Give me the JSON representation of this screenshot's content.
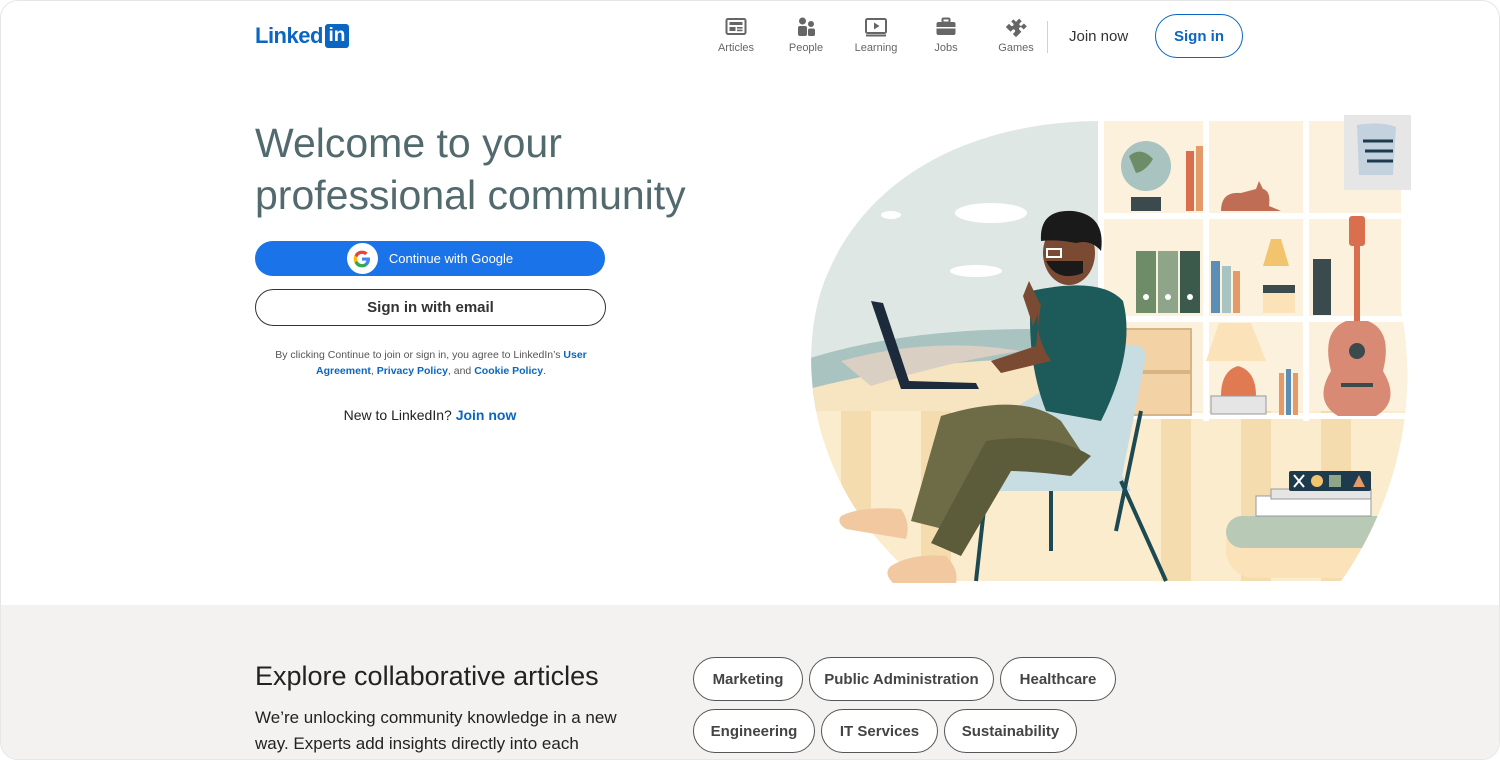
{
  "brand": {
    "logo_text": "Linked",
    "logo_box": "in"
  },
  "nav": {
    "items": [
      {
        "label": "Articles",
        "icon": "articles-icon"
      },
      {
        "label": "People",
        "icon": "people-icon"
      },
      {
        "label": "Learning",
        "icon": "learning-icon"
      },
      {
        "label": "Jobs",
        "icon": "jobs-icon"
      },
      {
        "label": "Games",
        "icon": "games-icon"
      }
    ],
    "join_label": "Join now",
    "signin_label": "Sign in"
  },
  "hero": {
    "title": "Welcome to your professional community",
    "google_label": "Continue with Google",
    "email_label": "Sign in with email",
    "legal_prefix": "By clicking Continue to join or sign in, you agree to LinkedIn’s ",
    "user_agreement": "User Agreement",
    "sep1": ", ",
    "privacy_policy": "Privacy Policy",
    "sep2": ", and ",
    "cookie_policy": "Cookie Policy",
    "legal_suffix": ".",
    "new_prefix": "New to LinkedIn? ",
    "new_join": "Join now"
  },
  "explore": {
    "title": "Explore collaborative articles",
    "description": "We’re unlocking community knowledge in a new way. Experts add insights directly into each",
    "topics": [
      "Marketing",
      "Public Administration",
      "Healthcare",
      "Engineering",
      "IT Services",
      "Sustainability"
    ]
  },
  "colors": {
    "brand": "#0a66c2",
    "google_blue": "#1a73e8",
    "title": "#526a6e",
    "bottom_bg": "#f3f2f0"
  }
}
